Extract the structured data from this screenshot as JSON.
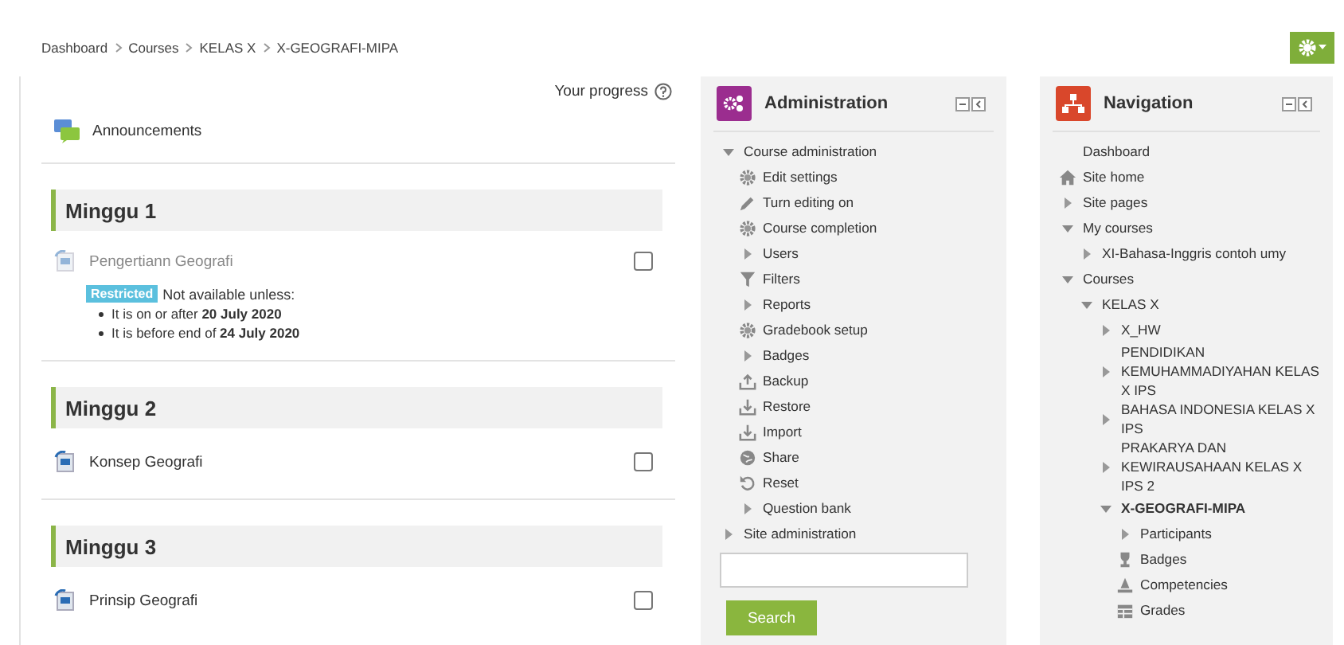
{
  "breadcrumb": [
    "Dashboard",
    "Courses",
    "KELAS X",
    "X-GEOGRAFI-MIPA"
  ],
  "progress_label": "Your progress",
  "announcements": "Announcements",
  "sections": [
    {
      "title": "Minggu 1",
      "activities": [
        {
          "name": "Pengertiann Geografi",
          "restricted": true,
          "checked": false,
          "restriction": {
            "badge": "Restricted",
            "intro": "Not available unless:",
            "conditions": [
              "It is on or after **20 July 2020**",
              "It is before end of **24 July 2020**"
            ]
          }
        }
      ]
    },
    {
      "title": "Minggu 2",
      "activities": [
        {
          "name": "Konsep Geografi",
          "restricted": false,
          "checked": false
        }
      ]
    },
    {
      "title": "Minggu 3",
      "activities": [
        {
          "name": "Prinsip Geografi",
          "restricted": false,
          "checked": false
        }
      ]
    }
  ],
  "administration": {
    "title": "Administration",
    "items": [
      {
        "label": "Course administration",
        "kind": "branch",
        "expanded": true,
        "children": [
          {
            "label": "Edit settings",
            "kind": "gear"
          },
          {
            "label": "Turn editing on",
            "kind": "pencil"
          },
          {
            "label": "Course completion",
            "kind": "gear"
          },
          {
            "label": "Users",
            "kind": "branch",
            "expanded": false
          },
          {
            "label": "Filters",
            "kind": "filter"
          },
          {
            "label": "Reports",
            "kind": "branch",
            "expanded": false
          },
          {
            "label": "Gradebook setup",
            "kind": "gear"
          },
          {
            "label": "Badges",
            "kind": "branch",
            "expanded": false
          },
          {
            "label": "Backup",
            "kind": "upload"
          },
          {
            "label": "Restore",
            "kind": "download"
          },
          {
            "label": "Import",
            "kind": "download"
          },
          {
            "label": "Share",
            "kind": "globe"
          },
          {
            "label": "Reset",
            "kind": "reset"
          },
          {
            "label": "Question bank",
            "kind": "branch",
            "expanded": false
          }
        ]
      },
      {
        "label": "Site administration",
        "kind": "branch",
        "expanded": false
      }
    ],
    "search_button": "Search"
  },
  "navigation": {
    "title": "Navigation",
    "items": [
      {
        "label": "Dashboard",
        "kind": "plain"
      },
      {
        "label": "Site home",
        "kind": "home"
      },
      {
        "label": "Site pages",
        "kind": "branch",
        "expanded": false
      },
      {
        "label": "My courses",
        "kind": "branch",
        "expanded": true,
        "children": [
          {
            "label": "XI-Bahasa-Inggris contoh umy",
            "kind": "branch",
            "expanded": false
          }
        ]
      },
      {
        "label": "Courses",
        "kind": "branch",
        "expanded": true,
        "children": [
          {
            "label": "KELAS X",
            "kind": "branch",
            "expanded": true,
            "children": [
              {
                "label": "X_HW",
                "kind": "branch",
                "expanded": false
              },
              {
                "label": "PENDIDIKAN KEMUHAMMADIYAHAN KELAS X IPS",
                "kind": "branch",
                "expanded": false
              },
              {
                "label": "BAHASA INDONESIA KELAS X IPS",
                "kind": "branch",
                "expanded": false
              },
              {
                "label": "PRAKARYA DAN KEWIRAUSAHAAN KELAS X IPS 2",
                "kind": "branch",
                "expanded": false
              },
              {
                "label": "X-GEOGRAFI-MIPA",
                "kind": "branch",
                "expanded": true,
                "current": true,
                "children": [
                  {
                    "label": "Participants",
                    "kind": "branch",
                    "expanded": false
                  },
                  {
                    "label": "Badges",
                    "kind": "trophy"
                  },
                  {
                    "label": "Competencies",
                    "kind": "level"
                  },
                  {
                    "label": "Grades",
                    "kind": "table"
                  }
                ]
              }
            ]
          }
        ]
      }
    ]
  }
}
